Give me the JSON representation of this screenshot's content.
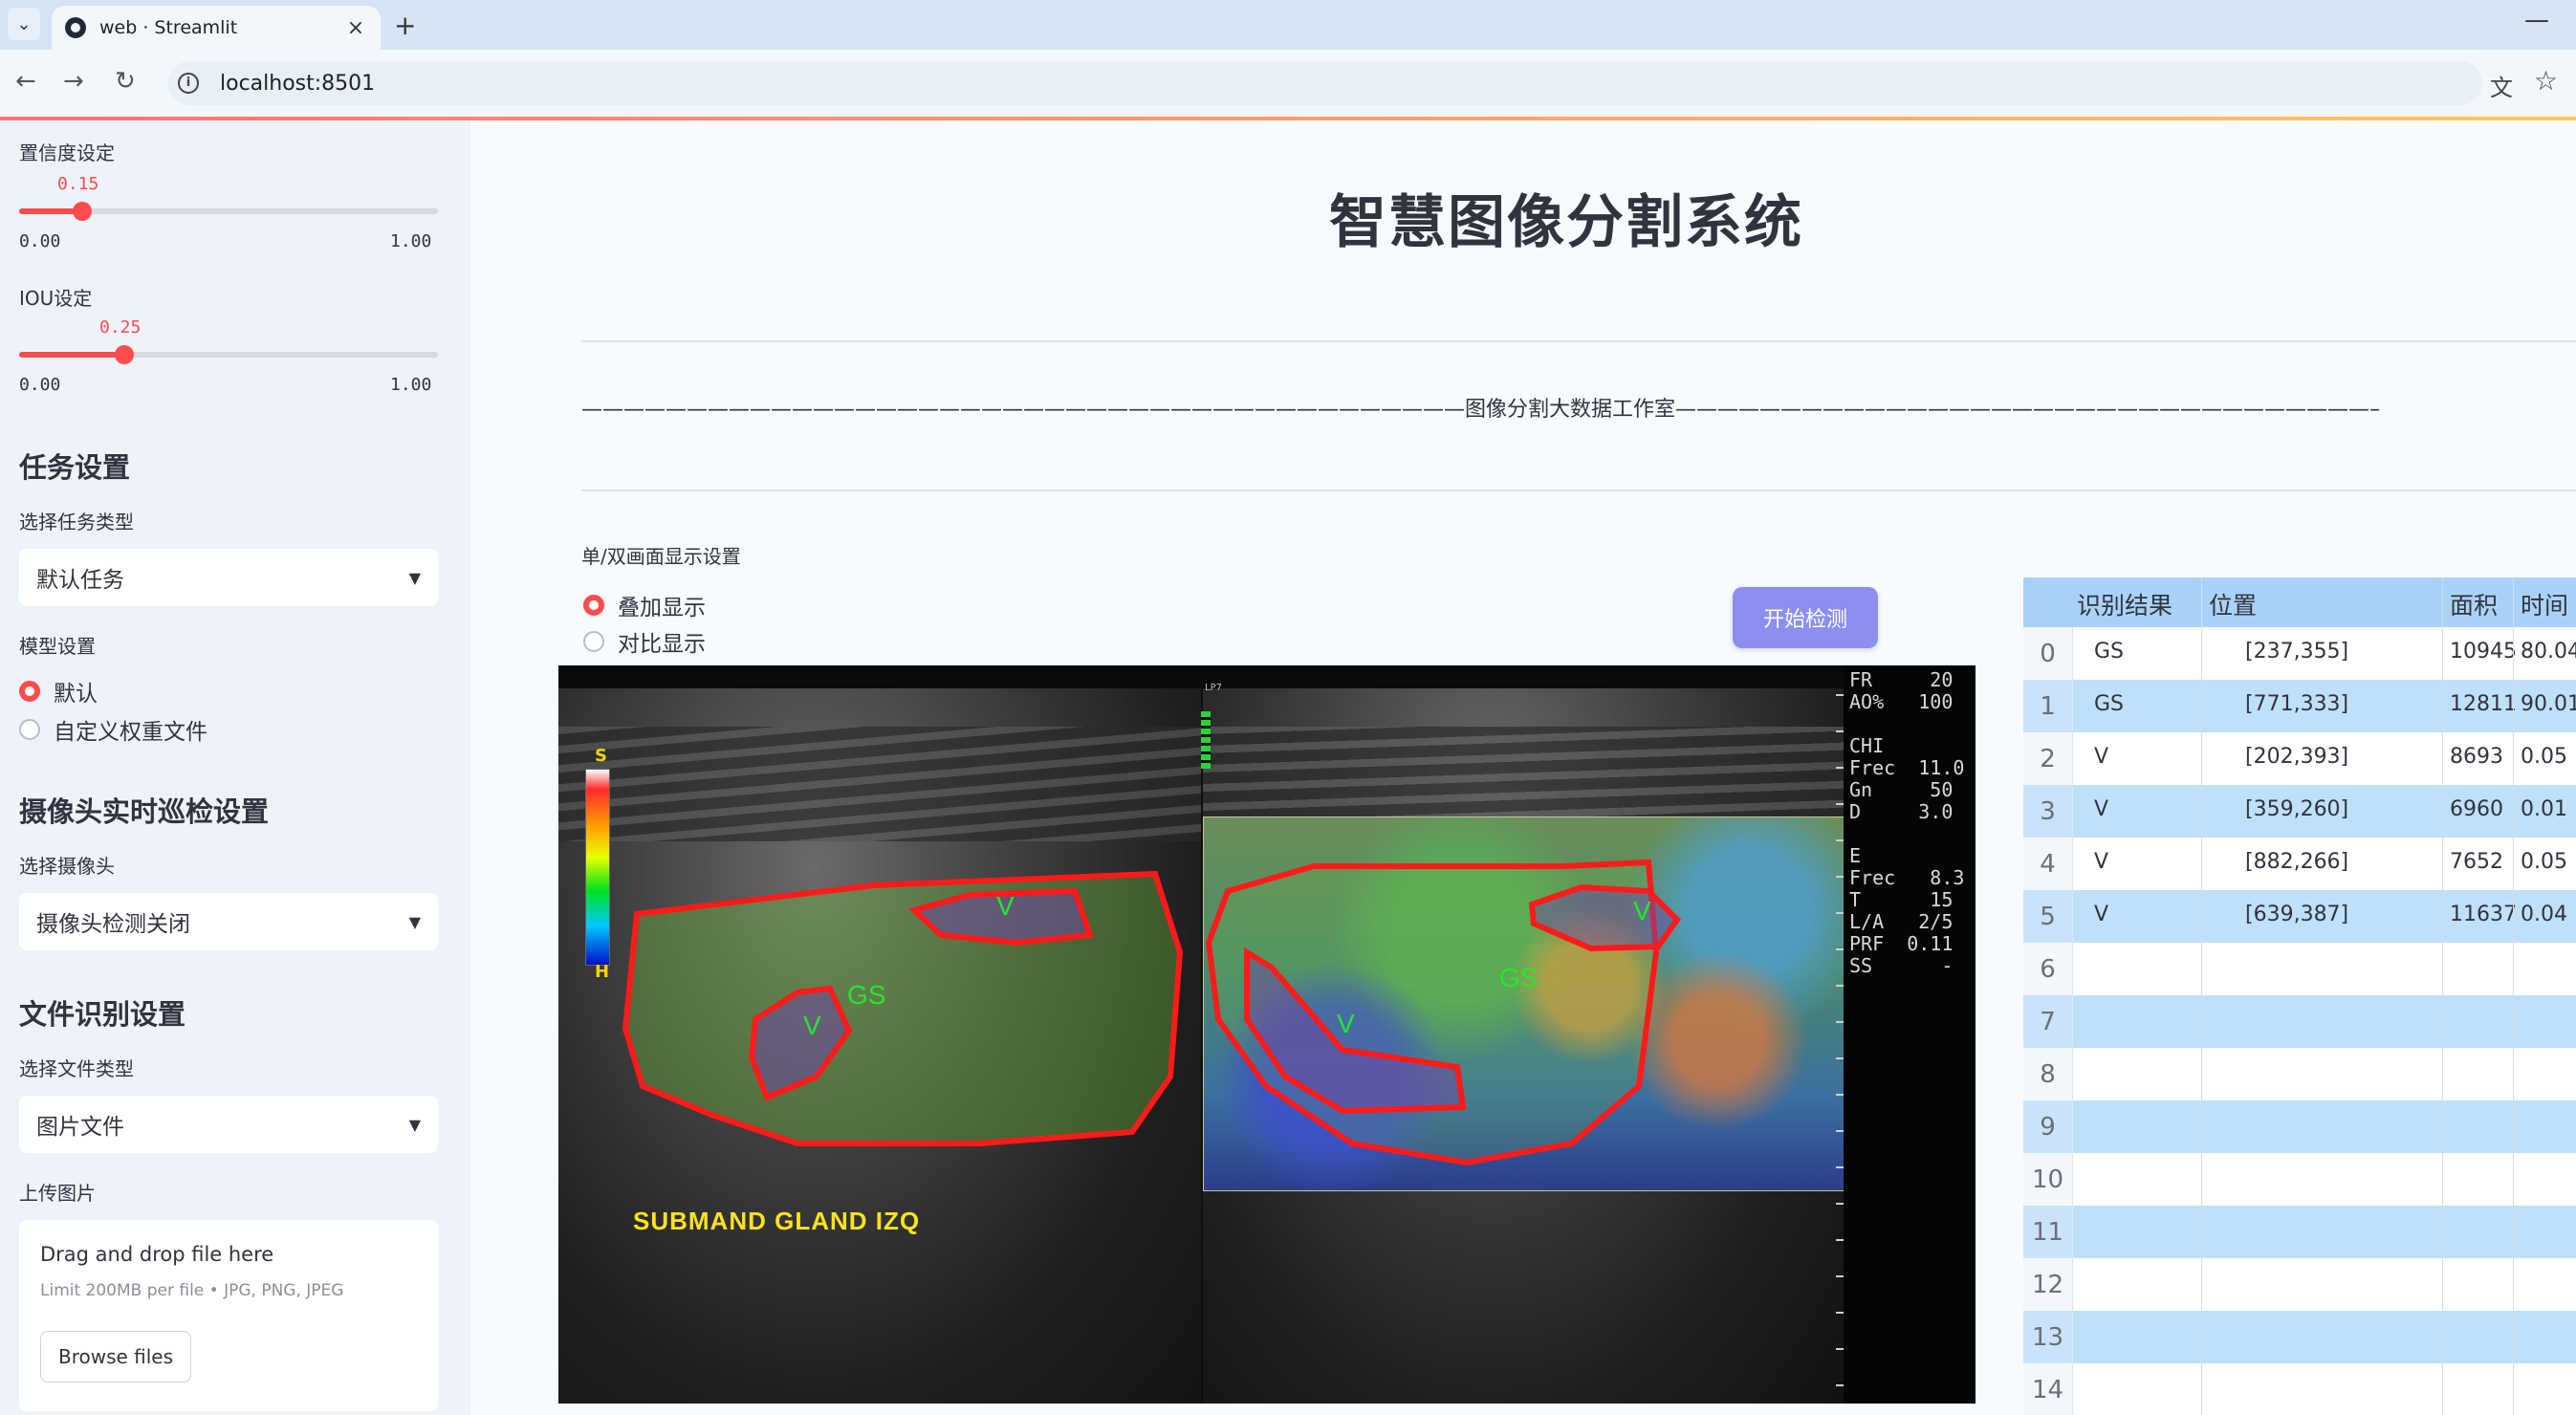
{
  "browser": {
    "tab_title": "web · Streamlit",
    "url": "localhost:8501"
  },
  "sidebar": {
    "confidence": {
      "label": "置信度设定",
      "value": "0.15",
      "value_num": 0.15,
      "min": "0.00",
      "max": "1.00"
    },
    "iou": {
      "label": "IOU设定",
      "value": "0.25",
      "value_num": 0.25,
      "min": "0.00",
      "max": "1.00"
    },
    "task_section": "任务设置",
    "task_type_label": "选择任务类型",
    "task_type_value": "默认任务",
    "model_label": "模型设置",
    "model_options": [
      "默认",
      "自定义权重文件"
    ],
    "model_selected": 0,
    "camera_section": "摄像头实时巡检设置",
    "camera_label": "选择摄像头",
    "camera_value": "摄像头检测关闭",
    "file_section": "文件识别设置",
    "file_type_label": "选择文件类型",
    "file_type_value": "图片文件",
    "upload_label": "上传图片",
    "upload_title": "Drag and drop file here",
    "upload_limit": "Limit 200MB per file • JPG, PNG, JPEG",
    "browse_label": "Browse files"
  },
  "main": {
    "title": "智慧图像分割系统",
    "studio_line": "——————————————————————————————————————————图像分割大数据工作室——————————————————————————————————————————",
    "display_label": "单/双画面显示设置",
    "display_options": [
      "叠加显示",
      "对比显示"
    ],
    "display_selected": 0,
    "start_button": "开始检测"
  },
  "ultrasound": {
    "gland_label": "SUBMAND GLAND IZQ",
    "probe_label": "LP7",
    "scale_top": "S",
    "scale_bottom": "H",
    "side_panel": "FR     20\nAO%   100\n\nCHI\nFrec  11.0\nGn     50\nD     3.0\n\nE\nFrec   8.3\nT      15\nL/A   2/5\nPRF  0.11\nSS      -",
    "region_labels": [
      "V",
      "GS",
      "V",
      "V",
      "GS",
      "V"
    ]
  },
  "table": {
    "columns": [
      "识别结果",
      "位置",
      "面积",
      "时间"
    ],
    "rows": [
      {
        "idx": "0",
        "result": "GS",
        "pos": "[237,355]",
        "area": "10945",
        "time": "80.04"
      },
      {
        "idx": "1",
        "result": "GS",
        "pos": "[771,333]",
        "area": "12811",
        "time": "90.01"
      },
      {
        "idx": "2",
        "result": "V",
        "pos": "[202,393]",
        "area": "8693",
        "time": "0.05"
      },
      {
        "idx": "3",
        "result": "V",
        "pos": "[359,260]",
        "area": "6960",
        "time": "0.01"
      },
      {
        "idx": "4",
        "result": "V",
        "pos": "[882,266]",
        "area": "7652",
        "time": "0.05"
      },
      {
        "idx": "5",
        "result": "V",
        "pos": "[639,387]",
        "area": "11637",
        "time": "0.04"
      },
      {
        "idx": "6",
        "result": "",
        "pos": "",
        "area": "",
        "time": ""
      },
      {
        "idx": "7",
        "result": "",
        "pos": "",
        "area": "",
        "time": ""
      },
      {
        "idx": "8",
        "result": "",
        "pos": "",
        "area": "",
        "time": ""
      },
      {
        "idx": "9",
        "result": "",
        "pos": "",
        "area": "",
        "time": ""
      },
      {
        "idx": "10",
        "result": "",
        "pos": "",
        "area": "",
        "time": ""
      },
      {
        "idx": "11",
        "result": "",
        "pos": "",
        "area": "",
        "time": ""
      },
      {
        "idx": "12",
        "result": "",
        "pos": "",
        "area": "",
        "time": ""
      },
      {
        "idx": "13",
        "result": "",
        "pos": "",
        "area": "",
        "time": ""
      },
      {
        "idx": "14",
        "result": "",
        "pos": "",
        "area": "",
        "time": ""
      }
    ]
  },
  "colors": {
    "accent": "#ff4b4b",
    "button": "#8c8ff0",
    "table_header": "#a9d3f6",
    "table_alt_row": "#bfe0fa",
    "seg_outline": "#ff1a1a",
    "seg_label": "#24e82c"
  }
}
